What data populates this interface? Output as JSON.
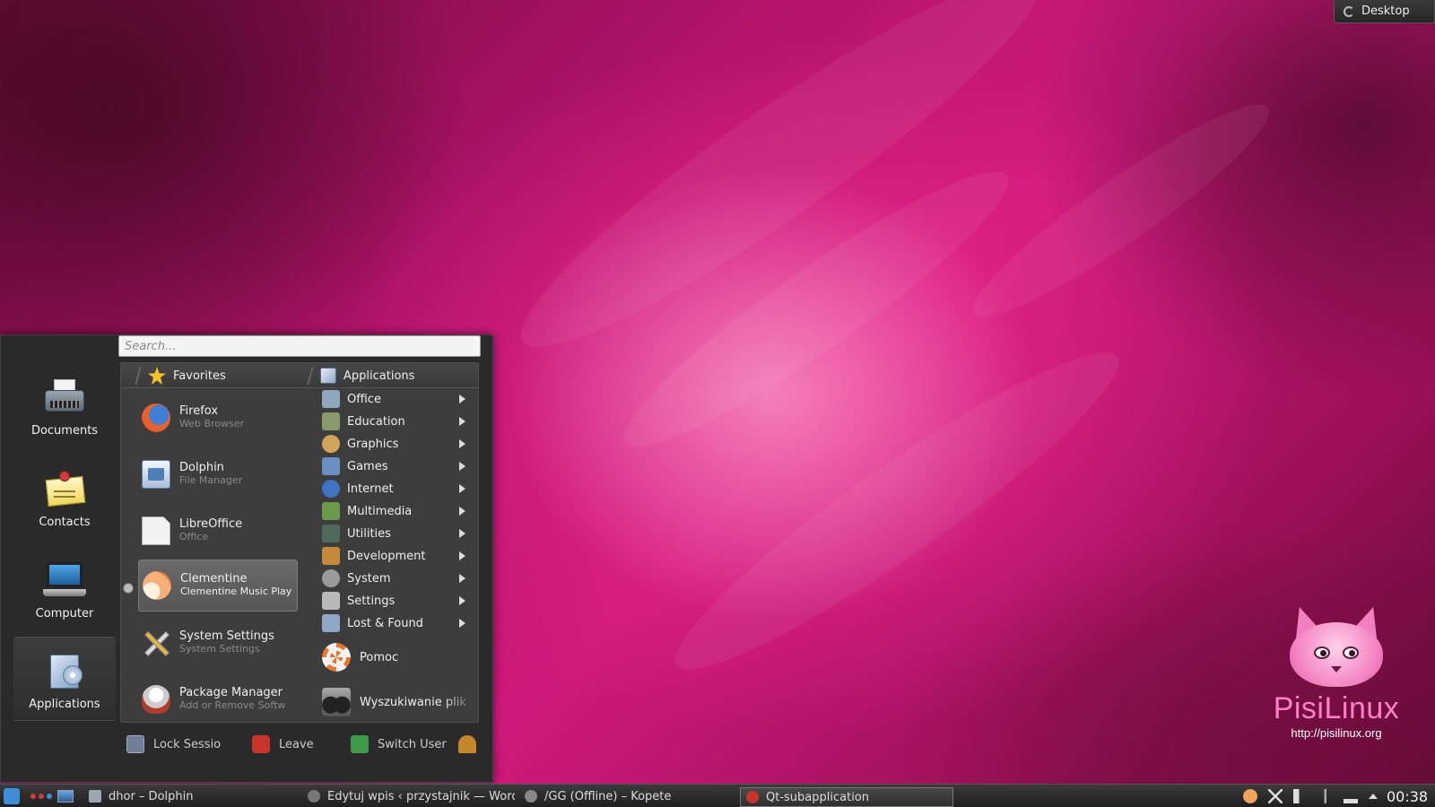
{
  "desktop_toolbox": {
    "label": "Desktop"
  },
  "logo": {
    "brand": "PisiLinux",
    "url": "http://pisilinux.org"
  },
  "kickoff": {
    "search": {
      "placeholder": "Search..."
    },
    "sidebar": [
      {
        "label": "Documents",
        "icon": "typewriter-icon"
      },
      {
        "label": "Contacts",
        "icon": "contacts-icon"
      },
      {
        "label": "Computer",
        "icon": "computer-icon"
      },
      {
        "label": "Applications",
        "icon": "applications-icon",
        "active": true
      }
    ],
    "favorites_header": "Favorites",
    "applications_header": "Applications",
    "favorites": [
      {
        "name": "Firefox",
        "desc": "Web Browser",
        "icon": "firefox-icon"
      },
      {
        "name": "Dolphin",
        "desc": "File Manager",
        "icon": "dolphin-icon"
      },
      {
        "name": "LibreOffice",
        "desc": "Office",
        "icon": "libreoffice-icon"
      },
      {
        "name": "Clementine",
        "desc": "Clementine Music Play",
        "icon": "clementine-icon",
        "hover": true
      },
      {
        "name": "System Settings",
        "desc": "System Settings",
        "icon": "system-settings-icon"
      },
      {
        "name": "Package Manager",
        "desc": "Add or Remove Softw",
        "icon": "package-manager-icon"
      }
    ],
    "categories": [
      {
        "label": "Office",
        "icon": "office-icon",
        "color": "#8fa7bd"
      },
      {
        "label": "Education",
        "icon": "education-icon",
        "color": "#8a9a6a"
      },
      {
        "label": "Graphics",
        "icon": "graphics-icon",
        "color": "#d2a55a"
      },
      {
        "label": "Games",
        "icon": "games-icon",
        "color": "#6b8fc0"
      },
      {
        "label": "Internet",
        "icon": "internet-icon",
        "color": "#3f74c2"
      },
      {
        "label": "Multimedia",
        "icon": "multimedia-icon",
        "color": "#6b9b4a"
      },
      {
        "label": "Utilities",
        "icon": "utilities-icon",
        "color": "#4e6a5a"
      },
      {
        "label": "Development",
        "icon": "development-icon",
        "color": "#c48a3a"
      },
      {
        "label": "System",
        "icon": "system-icon",
        "color": "#9a9a9a"
      },
      {
        "label": "Settings",
        "icon": "settings-icon",
        "color": "#b9b9b9"
      },
      {
        "label": "Lost & Found",
        "icon": "lost-found-icon",
        "color": "#8ea7c6"
      }
    ],
    "extras": [
      {
        "label": "Pomoc",
        "icon": "help-icon"
      },
      {
        "label": "Wyszukiwanie plik",
        "icon": "binoculars-icon"
      }
    ],
    "footer": {
      "lock": "Lock Sessior",
      "leave": "Leave",
      "switch": "Switch User"
    }
  },
  "taskbar": {
    "tasks": [
      {
        "label": "dhor – Dolphin",
        "icon": "dolphin-icon"
      },
      {
        "label": "Edytuj wpis ‹ przystajnik — Word",
        "icon": "browser-icon"
      },
      {
        "label": "/GG (Offline) – Kopete",
        "icon": "kopete-icon"
      },
      {
        "label": "Qt-subapplication",
        "icon": "app-icon",
        "active": true
      }
    ],
    "clock": "00:38"
  }
}
